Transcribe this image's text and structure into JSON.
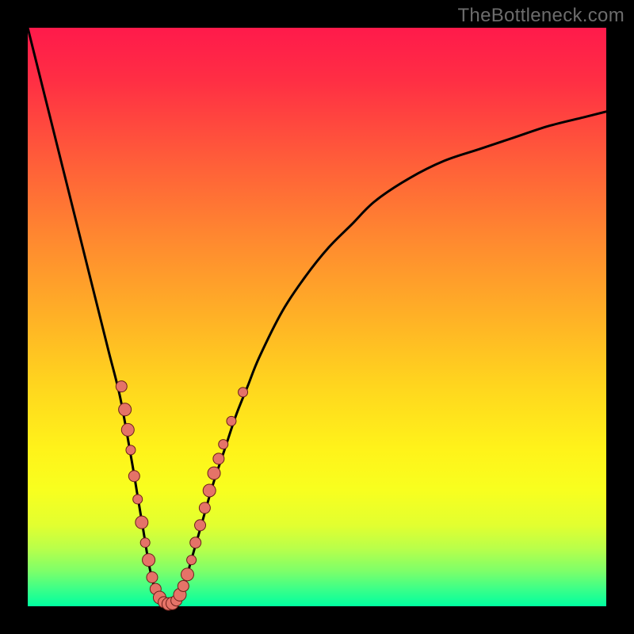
{
  "watermark": "TheBottleneck.com",
  "colors": {
    "frame": "#000000",
    "curve": "#000000",
    "dot_fill": "#e57368",
    "dot_stroke": "#6a1f1a"
  },
  "chart_data": {
    "type": "line",
    "title": "",
    "xlabel": "",
    "ylabel": "",
    "xlim": [
      0,
      100
    ],
    "ylim": [
      0,
      100
    ],
    "series": [
      {
        "name": "bottleneck-curve",
        "x": [
          0,
          2,
          4,
          6,
          8,
          10,
          12,
          14,
          16,
          18,
          19,
          20,
          21,
          22,
          23,
          24,
          25,
          26,
          27,
          28,
          30,
          32,
          34,
          36,
          38,
          40,
          44,
          48,
          52,
          56,
          60,
          66,
          72,
          78,
          84,
          90,
          96,
          100
        ],
        "y": [
          100,
          92,
          84,
          76,
          68,
          60,
          52,
          44,
          36,
          25,
          19,
          13,
          7,
          3,
          1,
          0,
          0,
          1,
          3,
          7,
          14,
          21,
          27,
          33,
          38,
          43,
          51,
          57,
          62,
          66,
          70,
          74,
          77,
          79,
          81,
          83,
          84.5,
          85.5
        ]
      }
    ],
    "dots": [
      {
        "x": 16.2,
        "y": 38.0,
        "r": 7
      },
      {
        "x": 16.8,
        "y": 34.0,
        "r": 8
      },
      {
        "x": 17.3,
        "y": 30.5,
        "r": 8
      },
      {
        "x": 17.8,
        "y": 27.0,
        "r": 6
      },
      {
        "x": 18.4,
        "y": 22.5,
        "r": 7
      },
      {
        "x": 19.0,
        "y": 18.5,
        "r": 6
      },
      {
        "x": 19.7,
        "y": 14.5,
        "r": 8
      },
      {
        "x": 20.3,
        "y": 11.0,
        "r": 6
      },
      {
        "x": 20.9,
        "y": 8.0,
        "r": 8
      },
      {
        "x": 21.5,
        "y": 5.0,
        "r": 7
      },
      {
        "x": 22.1,
        "y": 3.0,
        "r": 7
      },
      {
        "x": 22.8,
        "y": 1.5,
        "r": 8
      },
      {
        "x": 23.5,
        "y": 0.7,
        "r": 7
      },
      {
        "x": 24.3,
        "y": 0.4,
        "r": 8
      },
      {
        "x": 25.0,
        "y": 0.5,
        "r": 8
      },
      {
        "x": 25.7,
        "y": 1.0,
        "r": 7
      },
      {
        "x": 26.3,
        "y": 2.0,
        "r": 8
      },
      {
        "x": 26.9,
        "y": 3.5,
        "r": 7
      },
      {
        "x": 27.6,
        "y": 5.5,
        "r": 8
      },
      {
        "x": 28.3,
        "y": 8.0,
        "r": 6
      },
      {
        "x": 29.0,
        "y": 11.0,
        "r": 7
      },
      {
        "x": 29.8,
        "y": 14.0,
        "r": 7
      },
      {
        "x": 30.6,
        "y": 17.0,
        "r": 7
      },
      {
        "x": 31.4,
        "y": 20.0,
        "r": 8
      },
      {
        "x": 32.2,
        "y": 23.0,
        "r": 8
      },
      {
        "x": 33.0,
        "y": 25.5,
        "r": 7
      },
      {
        "x": 33.8,
        "y": 28.0,
        "r": 6
      },
      {
        "x": 35.2,
        "y": 32.0,
        "r": 6
      },
      {
        "x": 37.2,
        "y": 37.0,
        "r": 6
      }
    ]
  }
}
